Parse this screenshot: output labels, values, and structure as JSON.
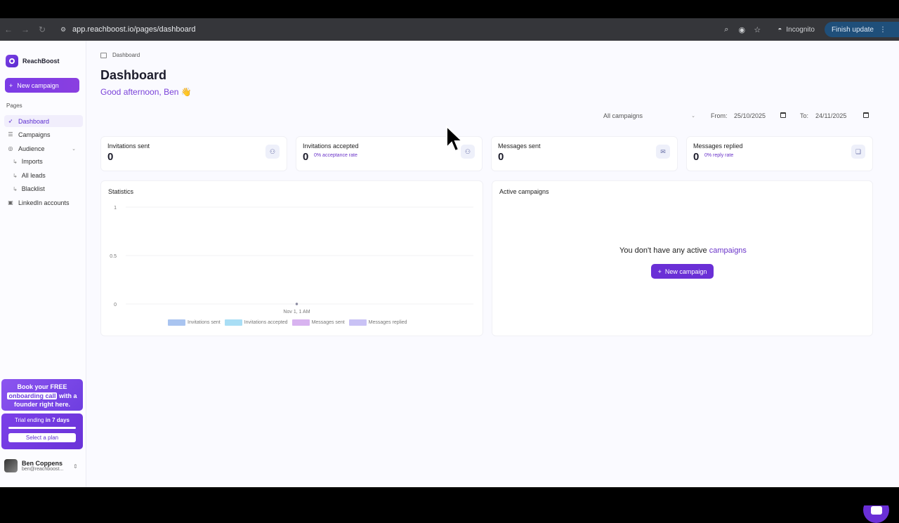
{
  "browser": {
    "url": "app.reachboost.io/pages/dashboard",
    "incognito_label": "Incognito",
    "update_label": "Finish update"
  },
  "sidebar": {
    "brand": "ReachBoost",
    "new_campaign": "New campaign",
    "section": "Pages",
    "items": [
      {
        "label": "Dashboard"
      },
      {
        "label": "Campaigns"
      },
      {
        "label": "Audience"
      },
      {
        "label": "Imports"
      },
      {
        "label": "All leads"
      },
      {
        "label": "Blacklist"
      },
      {
        "label": "LinkedIn accounts"
      }
    ],
    "promo": {
      "line1": "Book your FREE",
      "highlight": "onboarding call",
      "line2": "with a",
      "line3": "founder right here."
    },
    "trial": {
      "prefix": "Trial ending",
      "bold": "in 7 days",
      "button": "Select a plan"
    },
    "user": {
      "name": "Ben Coppens",
      "email": "ben@reachboost..."
    }
  },
  "main": {
    "breadcrumb": "Dashboard",
    "title": "Dashboard",
    "greeting": "Good afternoon, Ben 👋",
    "filters": {
      "campaign_select": "All campaigns",
      "from_label": "From:",
      "from_value": "25/10/2025",
      "to_label": "To:",
      "to_value": "24/11/2025"
    },
    "stats": [
      {
        "label": "Invitations sent",
        "value": "0",
        "sub": "",
        "icon": "user-add-icon"
      },
      {
        "label": "Invitations accepted",
        "value": "0",
        "sub": "0% acceptance rate",
        "icon": "user-check-icon"
      },
      {
        "label": "Messages sent",
        "value": "0",
        "sub": "",
        "icon": "mail-icon"
      },
      {
        "label": "Messages replied",
        "value": "0",
        "sub": "0% reply rate",
        "icon": "chat-icon"
      }
    ],
    "statistics_title": "Statistics",
    "active_campaigns": {
      "title": "Active campaigns",
      "empty_prefix": "You don't have any active",
      "empty_link": "campaigns",
      "button": "New campaign"
    }
  },
  "chart_data": {
    "type": "line",
    "title": "Statistics",
    "x": [
      "Nov 1, 1 AM"
    ],
    "y_ticks": [
      "1",
      "0.5",
      "0"
    ],
    "ylim": [
      0,
      1
    ],
    "series": [
      {
        "name": "Invitations sent",
        "values": [
          0
        ],
        "color": "#a9c4f0"
      },
      {
        "name": "Invitations accepted",
        "values": [
          0
        ],
        "color": "#a9def5"
      },
      {
        "name": "Messages sent",
        "values": [
          0
        ],
        "color": "#d8b3f0"
      },
      {
        "name": "Messages replied",
        "values": [
          0
        ],
        "color": "#c9c2f5"
      }
    ]
  }
}
